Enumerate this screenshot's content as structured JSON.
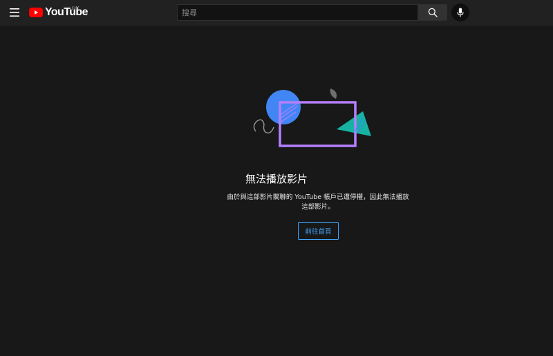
{
  "header": {
    "menu_icon": "hamburger-menu-icon",
    "logo": {
      "text": "YouTube",
      "region": "HK",
      "brand_color": "#ff0000"
    },
    "search": {
      "placeholder": "搜尋",
      "value": "",
      "search_icon": "search-icon"
    },
    "mic_icon": "microphone-icon"
  },
  "error": {
    "title": "無法播放影片",
    "message": "由於與這部影片關聯的 YouTube 帳戶已遭停權，因此無法播放這部影片。",
    "button_label": "前往首頁",
    "accent_color": "#3ea6ff"
  }
}
